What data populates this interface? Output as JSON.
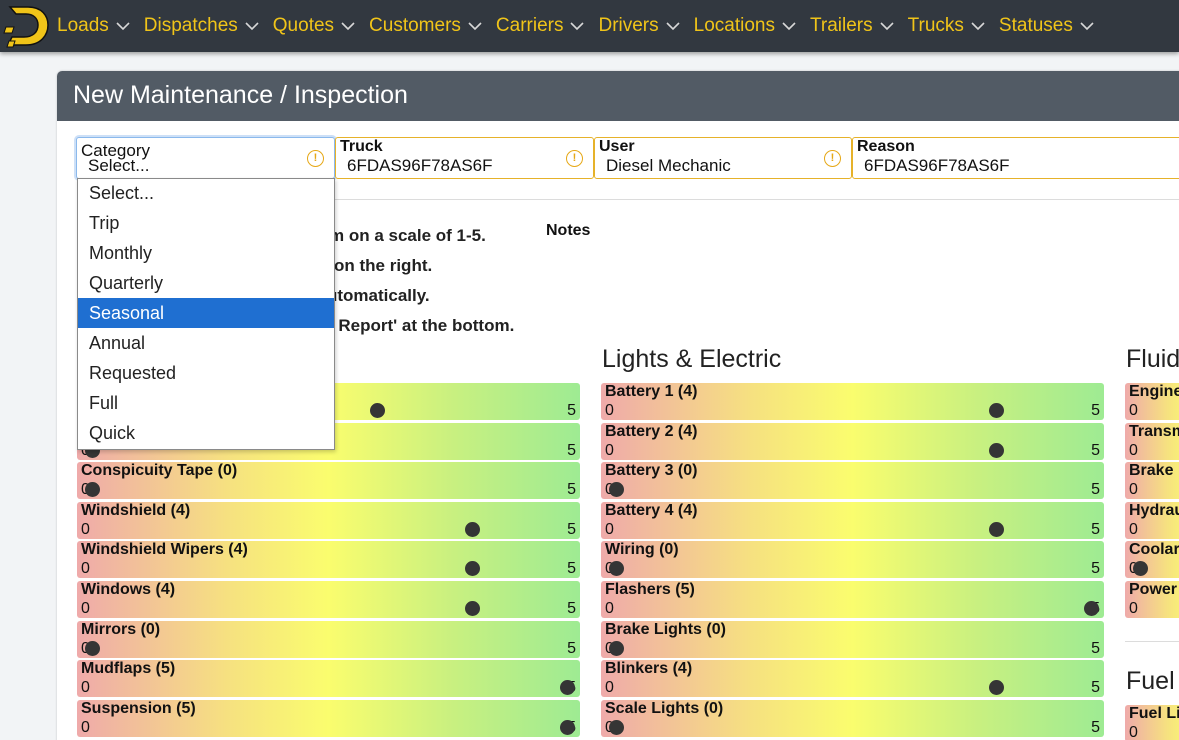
{
  "nav": {
    "items": [
      "Loads",
      "Dispatches",
      "Quotes",
      "Customers",
      "Carriers",
      "Drivers",
      "Locations",
      "Trailers",
      "Trucks",
      "Statuses"
    ],
    "accent": "#f0c419",
    "bg": "#323840"
  },
  "card": {
    "title": "New Maintenance / Inspection"
  },
  "form": {
    "category": {
      "label": "Category",
      "value": "Select..."
    },
    "truck": {
      "label": "Truck",
      "value": "6FDAS96F78AS6F"
    },
    "user": {
      "label": "User",
      "value": "Diesel Mechanic"
    },
    "reason": {
      "label": "Reason",
      "value": "6FDAS96F78AS6F"
    }
  },
  "dropdown": {
    "options": [
      "Select...",
      "Trip",
      "Monthly",
      "Quarterly",
      "Seasonal",
      "Annual",
      "Requested",
      "Full",
      "Quick"
    ],
    "highlighted": "Seasonal"
  },
  "instructions": [
    "m on a scale of 1-5.",
    "on the right.",
    "utomatically.",
    "t Report' at the bottom."
  ],
  "notes_label": "Notes",
  "scale": {
    "min": "0",
    "max": "5"
  },
  "sections": {
    "col1": {
      "title": "",
      "items": [
        {
          "label": "",
          "rating": 3
        },
        {
          "label": "",
          "rating": 0
        },
        {
          "label": "Conspicuity Tape (0)",
          "rating": 0
        },
        {
          "label": "Windshield (4)",
          "rating": 4
        },
        {
          "label": "Windshield Wipers (4)",
          "rating": 4
        },
        {
          "label": "Windows (4)",
          "rating": 4
        },
        {
          "label": "Mirrors (0)",
          "rating": 0
        },
        {
          "label": "Mudflaps (5)",
          "rating": 5
        },
        {
          "label": "Suspension (5)",
          "rating": 5
        }
      ]
    },
    "col2": {
      "title": "Lights & Electric",
      "items": [
        {
          "label": "Battery 1 (4)",
          "rating": 4
        },
        {
          "label": "Battery 2 (4)",
          "rating": 4
        },
        {
          "label": "Battery 3 (0)",
          "rating": 0
        },
        {
          "label": "Battery 4 (4)",
          "rating": 4
        },
        {
          "label": "Wiring (0)",
          "rating": 0
        },
        {
          "label": "Flashers (5)",
          "rating": 5
        },
        {
          "label": "Brake Lights (0)",
          "rating": 0
        },
        {
          "label": "Blinkers (4)",
          "rating": 4
        },
        {
          "label": "Scale Lights (0)",
          "rating": 0
        }
      ]
    },
    "col3": {
      "title": "Fluid",
      "items": [
        {
          "label": "Engine",
          "rating": null
        },
        {
          "label": "Transm",
          "rating": null
        },
        {
          "label": "Brake",
          "rating": null
        },
        {
          "label": "Hydrau",
          "rating": null
        },
        {
          "label": "Coolar",
          "rating": 0
        },
        {
          "label": "Power",
          "rating": null
        }
      ]
    },
    "col3b": {
      "title": "Fuel",
      "items": [
        {
          "label": "Fuel Li",
          "rating": null
        }
      ]
    }
  }
}
